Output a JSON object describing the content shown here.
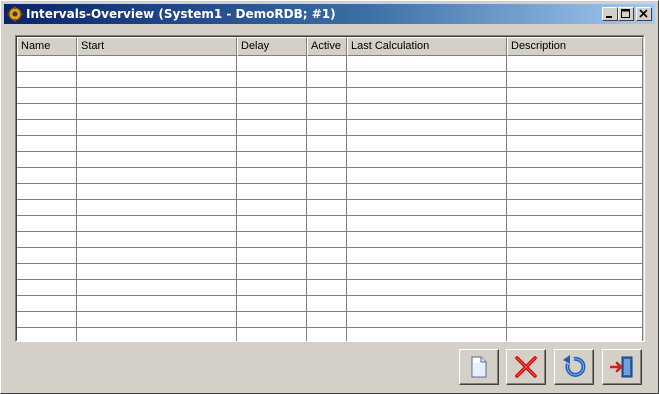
{
  "window": {
    "title": "Intervals-Overview (System1 - DemoRDB; #1)",
    "controls": [
      "minimize-icon",
      "maximize-icon",
      "close-icon"
    ]
  },
  "table": {
    "columns": [
      "Name",
      "Start",
      "Delay",
      "Active",
      "Last Calculation",
      "Description"
    ],
    "rows": []
  },
  "actions": {
    "buttons": [
      {
        "name": "new-button",
        "icon": "new-document-icon"
      },
      {
        "name": "delete-button",
        "icon": "delete-x-icon"
      },
      {
        "name": "refresh-button",
        "icon": "refresh-arrow-icon"
      },
      {
        "name": "exit-button",
        "icon": "exit-door-icon"
      }
    ]
  },
  "colors": {
    "title_gradient_start": "#0a246a",
    "title_gradient_end": "#a6caf0",
    "face": "#d4d0c8",
    "delete_red": "#cc0000",
    "refresh_blue": "#1f5fb4"
  }
}
